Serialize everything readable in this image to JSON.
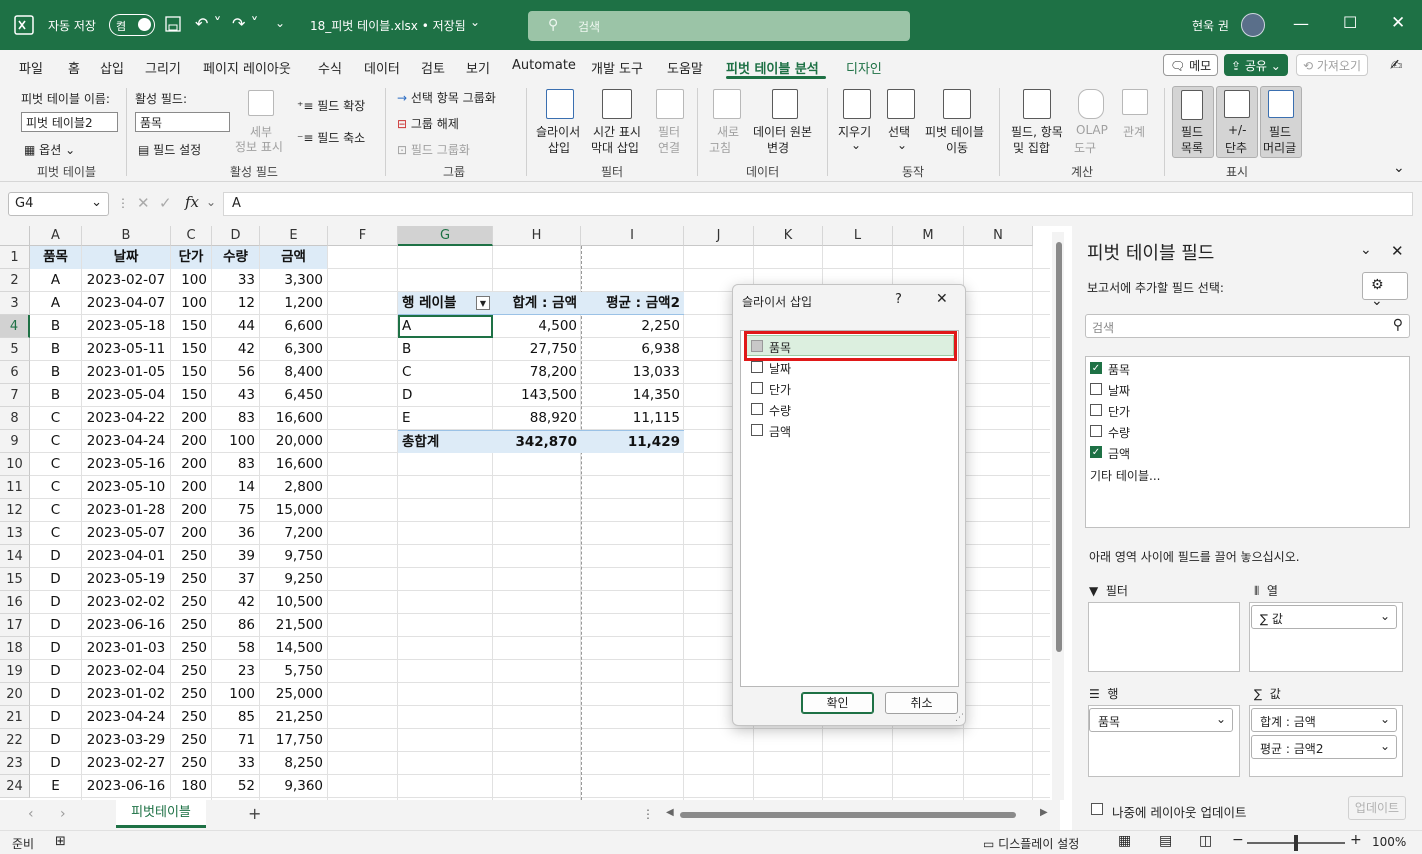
{
  "title": {
    "autosave": "자동 저장",
    "toggle": "켬",
    "filename": "18_피벗 테이블.xlsx • 저장됨",
    "search_placeholder": "검색",
    "user": "현욱 권"
  },
  "menu": {
    "tabs": [
      "파일",
      "홈",
      "삽입",
      "그리기",
      "페이지 레이아웃",
      "수식",
      "데이터",
      "검토",
      "보기",
      "Automate",
      "개발 도구",
      "도움말",
      "피벗 테이블 분석",
      "디자인"
    ],
    "memo": "메모",
    "share": "공유",
    "fetch": "가져오기"
  },
  "ribbon": {
    "pt_name_label": "피벗 테이블 이름:",
    "pt_name": "피벗 테이블2",
    "options": "옵션",
    "grp_pt": "피벗 테이블",
    "active_field_label": "활성 필드:",
    "active_field": "품목",
    "field_settings": "필드 설정",
    "drill_1": "세부",
    "drill_2": "정보 표시",
    "expand": "필드 확장",
    "collapse": "필드 축소",
    "grp_active": "활성 필드",
    "group_sel": "선택 항목 그룹화",
    "ungroup": "그룹 해제",
    "group_field": "필드 그룹화",
    "grp_group": "그룹",
    "slicer_1": "슬라이서",
    "slicer_2": "삽입",
    "timeline_1": "시간 표시",
    "timeline_2": "막대 삽입",
    "filterconn_1": "필터",
    "filterconn_2": "연결",
    "grp_filter": "필터",
    "refresh_1": "새로",
    "refresh_2": "고침",
    "changesrc_1": "데이터 원본",
    "changesrc_2": "변경",
    "grp_data": "데이터",
    "clear": "지우기",
    "select": "선택",
    "move_1": "피벗 테이블",
    "move_2": "이동",
    "grp_action": "동작",
    "calc_1": "필드, 항목",
    "calc_2": "및 집합",
    "olap_1": "OLAP",
    "olap_2": "도구",
    "relations": "관계",
    "grp_calc": "계산",
    "fieldlist_1": "필드",
    "fieldlist_2": "목록",
    "pm_1": "+/-",
    "pm_2": "단추",
    "headers_1": "필드",
    "headers_2": "머리글",
    "grp_show": "표시"
  },
  "formula": {
    "namebox": "G4",
    "value": "A"
  },
  "columns": [
    "A",
    "B",
    "C",
    "D",
    "E",
    "F",
    "G",
    "H",
    "I",
    "J",
    "K",
    "L",
    "M",
    "N"
  ],
  "rows": [
    [
      "품목",
      "날짜",
      "단가",
      "수량",
      "금액"
    ],
    [
      "A",
      "2023-02-07",
      "100",
      "33",
      "3,300"
    ],
    [
      "A",
      "2023-04-07",
      "100",
      "12",
      "1,200"
    ],
    [
      "B",
      "2023-05-18",
      "150",
      "44",
      "6,600"
    ],
    [
      "B",
      "2023-05-11",
      "150",
      "42",
      "6,300"
    ],
    [
      "B",
      "2023-01-05",
      "150",
      "56",
      "8,400"
    ],
    [
      "B",
      "2023-05-04",
      "150",
      "43",
      "6,450"
    ],
    [
      "C",
      "2023-04-22",
      "200",
      "83",
      "16,600"
    ],
    [
      "C",
      "2023-04-24",
      "200",
      "100",
      "20,000"
    ],
    [
      "C",
      "2023-05-16",
      "200",
      "83",
      "16,600"
    ],
    [
      "C",
      "2023-05-10",
      "200",
      "14",
      "2,800"
    ],
    [
      "C",
      "2023-01-28",
      "200",
      "75",
      "15,000"
    ],
    [
      "C",
      "2023-05-07",
      "200",
      "36",
      "7,200"
    ],
    [
      "D",
      "2023-04-01",
      "250",
      "39",
      "9,750"
    ],
    [
      "D",
      "2023-05-19",
      "250",
      "37",
      "9,250"
    ],
    [
      "D",
      "2023-02-02",
      "250",
      "42",
      "10,500"
    ],
    [
      "D",
      "2023-06-16",
      "250",
      "86",
      "21,500"
    ],
    [
      "D",
      "2023-01-03",
      "250",
      "58",
      "14,500"
    ],
    [
      "D",
      "2023-02-04",
      "250",
      "23",
      "5,750"
    ],
    [
      "D",
      "2023-01-02",
      "250",
      "100",
      "25,000"
    ],
    [
      "D",
      "2023-04-24",
      "250",
      "85",
      "21,250"
    ],
    [
      "D",
      "2023-03-29",
      "250",
      "71",
      "17,750"
    ],
    [
      "D",
      "2023-02-27",
      "250",
      "33",
      "8,250"
    ],
    [
      "E",
      "2023-06-16",
      "180",
      "52",
      "9,360"
    ]
  ],
  "pivot": {
    "headers": [
      "행 레이블",
      "합계 : 금액",
      "평균 : 금액2"
    ],
    "rows": [
      [
        "A",
        "4,500",
        "2,250"
      ],
      [
        "B",
        "27,750",
        "6,938"
      ],
      [
        "C",
        "78,200",
        "13,033"
      ],
      [
        "D",
        "143,500",
        "14,350"
      ],
      [
        "E",
        "88,920",
        "11,115"
      ]
    ],
    "total": [
      "총합계",
      "342,870",
      "11,429"
    ]
  },
  "dialog": {
    "title": "슬라이서 삽입",
    "help": "?",
    "fields": [
      "품목",
      "날짜",
      "단가",
      "수량",
      "금액"
    ],
    "ok": "확인",
    "cancel": "취소"
  },
  "pane": {
    "title": "피벗 테이블 필드",
    "subtitle": "보고서에 추가할 필드 선택:",
    "search_placeholder": "검색",
    "fields": [
      "품목",
      "날짜",
      "단가",
      "수량",
      "금액"
    ],
    "more": "기타 테이블...",
    "drag_hint": "아래 영역 사이에 필드를 끌어 놓으십시오.",
    "filters": "필터",
    "columns": "열",
    "rows": "행",
    "values": "값",
    "col_item": "∑ 값",
    "row_item": "품목",
    "val_item1": "합계 : 금액",
    "val_item2": "평균 : 금액2",
    "defer": "나중에 레이아웃 업데이트",
    "update": "업데이트"
  },
  "sheet_tab": "피벗테이블",
  "status": {
    "ready": "준비",
    "display": "디스플레이 설정",
    "zoom": "100%"
  }
}
